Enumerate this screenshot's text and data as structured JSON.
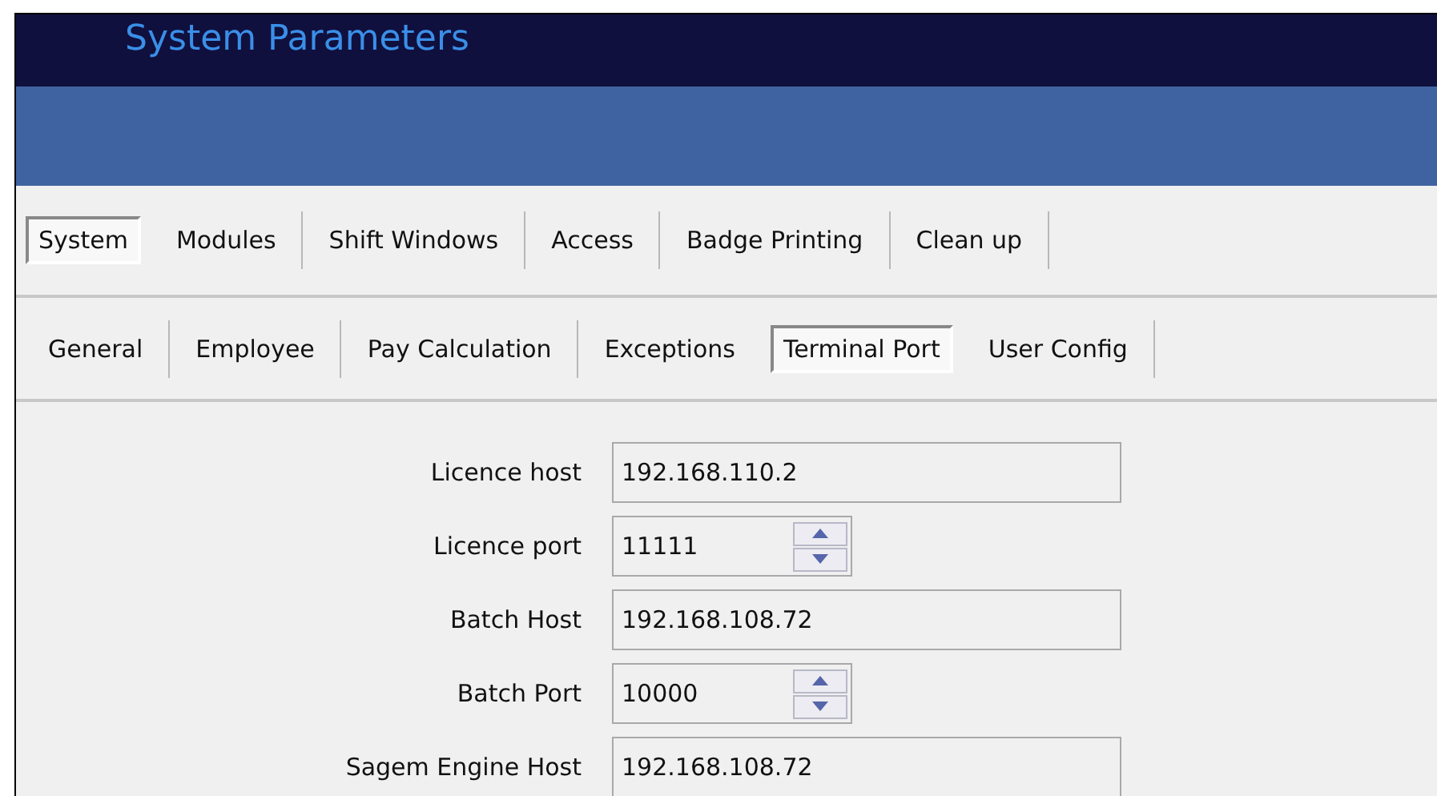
{
  "window": {
    "title": "System Parameters"
  },
  "tabs": [
    {
      "label": "System",
      "selected": true
    },
    {
      "label": "Modules",
      "selected": false
    },
    {
      "label": "Shift Windows",
      "selected": false
    },
    {
      "label": "Access",
      "selected": false
    },
    {
      "label": "Badge Printing",
      "selected": false
    },
    {
      "label": "Clean up",
      "selected": false
    }
  ],
  "subtabs": [
    {
      "label": "General",
      "selected": false
    },
    {
      "label": "Employee",
      "selected": false
    },
    {
      "label": "Pay Calculation",
      "selected": false
    },
    {
      "label": "Exceptions",
      "selected": false
    },
    {
      "label": "Terminal Port",
      "selected": true
    },
    {
      "label": "User Config",
      "selected": false
    }
  ],
  "fields": [
    {
      "label": "Licence host",
      "kind": "text",
      "value": "192.168.110.2"
    },
    {
      "label": "Licence port",
      "kind": "spin",
      "value": "11111"
    },
    {
      "label": "Batch Host",
      "kind": "text",
      "value": "192.168.108.72"
    },
    {
      "label": "Batch Port",
      "kind": "spin",
      "value": "10000"
    },
    {
      "label": "Sagem Engine Host",
      "kind": "text",
      "value": "192.168.108.72"
    }
  ]
}
